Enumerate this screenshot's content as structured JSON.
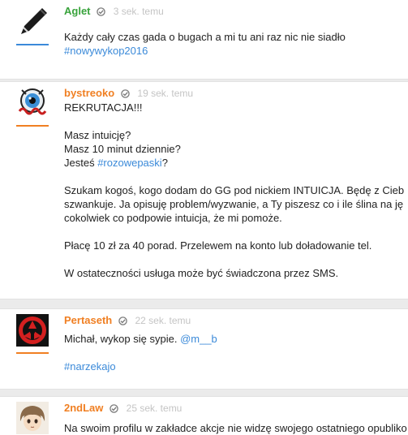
{
  "colors": {
    "tag_link": "#3b8ad9",
    "author_green": "#39a33c",
    "author_orange": "#f07f22",
    "check_grey": "#7a7a7a",
    "time_grey": "#c4c4c4",
    "avatar_line_blue": "#3b8ad9",
    "avatar_line_orange": "#f07f22"
  },
  "entries": [
    {
      "author": "Aglet",
      "author_color": "green",
      "avatar_icon": "pen-icon",
      "time": "3 sek. temu",
      "lines": {
        "l1": "Każdy cały czas gada o bugach a mi tu ani raz nic nie siadło",
        "tag": "#nowywykop2016"
      }
    },
    {
      "author": "bystreoko",
      "author_color": "orange",
      "avatar_icon": "eye-avatar-icon",
      "time": "19 sek. temu",
      "lines": {
        "l1": "REKRUTACJA!!!",
        "l2": "Masz intuicję?",
        "l3": "Masz 10 minut dziennie?",
        "l4_pre": "Jesteś ",
        "l4_tag": "#rozowepaski",
        "l4_post": "?",
        "l5": "Szukam kogoś, kogo dodam do GG pod nickiem INTUICJA. Będę z Cieb",
        "l6": "szwankuje. Ja opisuję problem/wyzwanie, a Ty piszesz co i ile ślina na ję",
        "l7": "cokolwiek co podpowie intuicja, że mi pomoże.",
        "l8": "Płacę 10 zł za 40 porad. Przelewem na konto lub doładowanie tel.",
        "l9": "W ostateczności usługa może być świadczona przez SMS."
      }
    },
    {
      "author": "Pertaseth",
      "author_color": "orange",
      "avatar_icon": "red-triskelion-icon",
      "time": "22 sek. temu",
      "lines": {
        "l1_pre": "Michał, wykop się sypie. ",
        "l1_mention": "@m__b",
        "tag": "#narzekajo"
      }
    },
    {
      "author": "2ndLaw",
      "author_color": "orange",
      "avatar_icon": "anime-face-icon",
      "time": "25 sek. temu",
      "lines": {
        "l1": "Na swoim profilu w zakładce akcje nie widzę swojego ostatniego opubliko"
      }
    }
  ]
}
